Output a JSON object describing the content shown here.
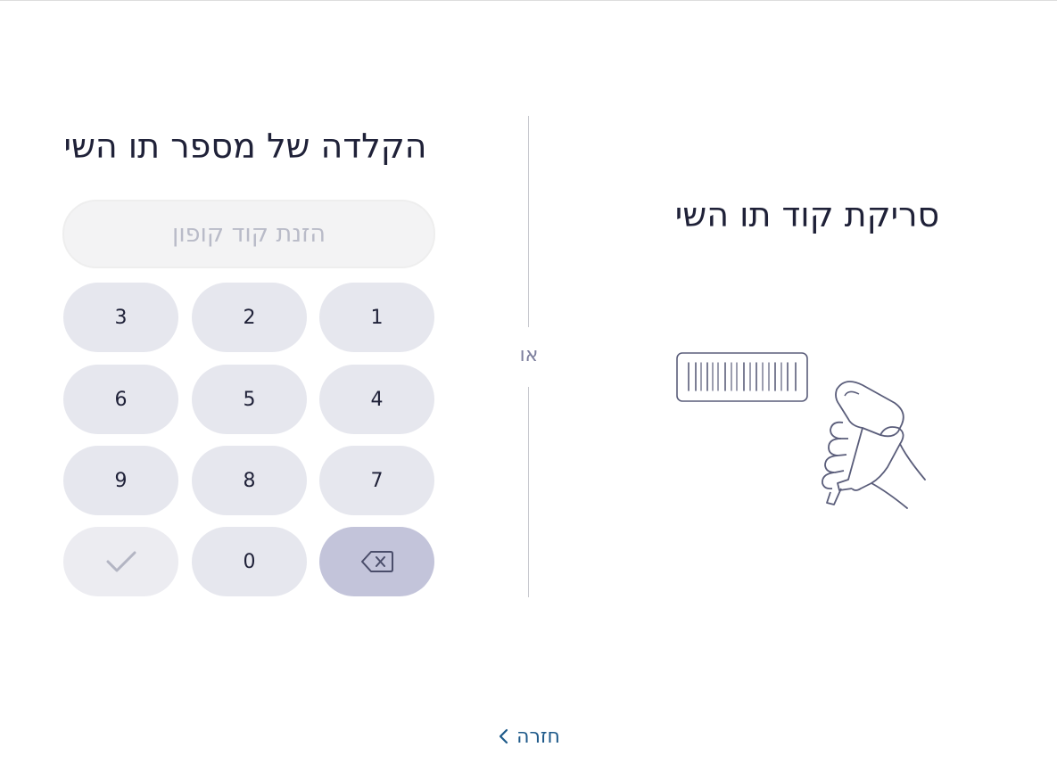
{
  "manual": {
    "title": "הקלדה של מספר תו השי",
    "coupon_placeholder": "הזנת קוד קופון",
    "coupon_value": "",
    "keys": [
      "1",
      "2",
      "3",
      "4",
      "5",
      "6",
      "7",
      "8",
      "9",
      "0"
    ]
  },
  "divider": {
    "or_label": "או"
  },
  "scan": {
    "title": "סריקת קוד תו השי"
  },
  "back": {
    "label": "חזרה"
  },
  "icons": {
    "confirm": "check-icon",
    "backspace": "backspace-icon",
    "scanner": "barcode-scanner-icon",
    "back": "chevron-left-icon"
  },
  "colors": {
    "key_bg": "#e6e7ee",
    "backspace_bg": "#c3c4da",
    "text": "#1f2138",
    "link": "#1f5a8a",
    "muted": "#7d7f9d"
  }
}
